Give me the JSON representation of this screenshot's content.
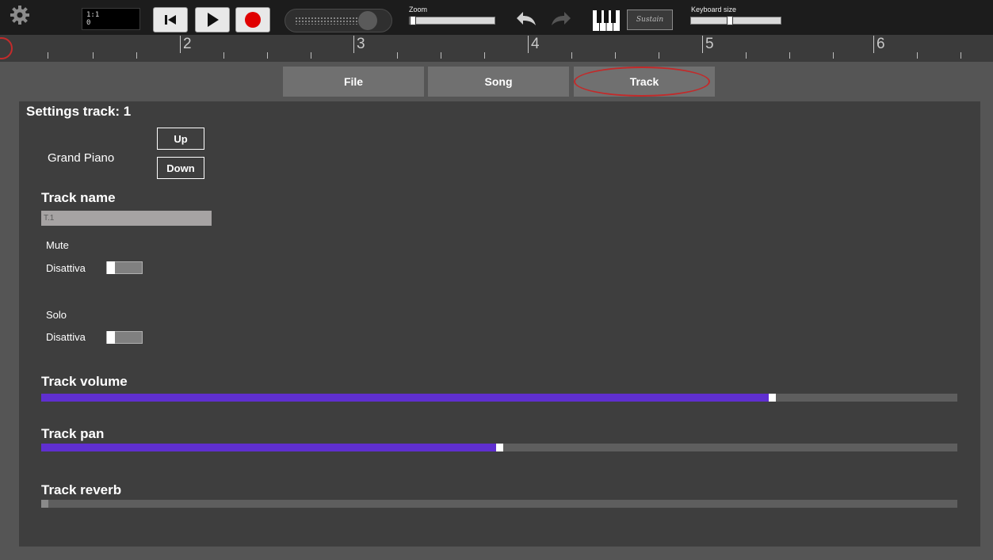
{
  "toolbar": {
    "position_bar_beat": "1:1",
    "position_tick": "0",
    "zoom_label": "Zoom",
    "zoom_level": 0.0,
    "keyboard_size_label": "Keyboard size",
    "keyboard_size_level": 0.42,
    "sustain_label": "Sustain",
    "icons": {
      "settings": "gear-icon",
      "rewind": "skip-to-start-icon",
      "play": "play-icon",
      "record": "record-icon",
      "undo": "undo-icon",
      "redo": "redo-icon",
      "keyboard": "piano-keys-icon"
    },
    "colors": {
      "record": "#e00000"
    }
  },
  "ruler": {
    "bars": [
      "2",
      "3",
      "4",
      "5",
      "6"
    ]
  },
  "tabs": [
    {
      "label": "File"
    },
    {
      "label": "Song"
    },
    {
      "label": "Track",
      "selected": true
    }
  ],
  "panel": {
    "title": "Settings track: 1",
    "instrument": "Grand Piano",
    "up_label": "Up",
    "down_label": "Down",
    "track_name_label": "Track name",
    "track_name_value": "T.1",
    "mute_label": "Mute",
    "mute_state": "Disattiva",
    "solo_label": "Solo",
    "solo_state": "Disattiva",
    "volume_label": "Track volume",
    "volume_level": 0.8,
    "pan_label": "Track pan",
    "pan_level": 0.5,
    "reverb_label": "Track reverb",
    "reverb_level": 0.0,
    "colors": {
      "accent": "#5f2fcf",
      "highlight": "#c22a2a"
    }
  }
}
